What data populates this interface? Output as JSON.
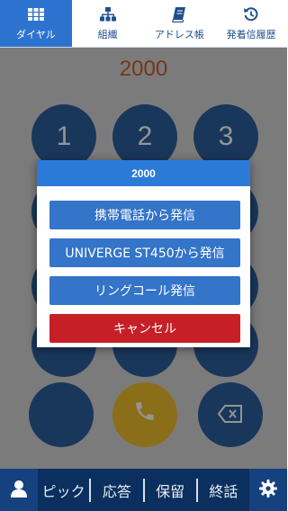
{
  "tabs": [
    {
      "label": "ダイヤル",
      "icon": "keypad-grid-icon",
      "active": true
    },
    {
      "label": "組織",
      "icon": "org-chart-icon",
      "active": false
    },
    {
      "label": "アドレス帳",
      "icon": "address-book-icon",
      "active": false
    },
    {
      "label": "発着信履歴",
      "icon": "call-history-icon",
      "active": false
    }
  ],
  "dialpad": {
    "number": "2000",
    "keys": [
      "1",
      "2",
      "3"
    ]
  },
  "dialog": {
    "title": "2000",
    "options": [
      {
        "label": "携帯電話から発信"
      },
      {
        "label": "UNIVERGE ST450から発信"
      },
      {
        "label": "リングコール発信"
      }
    ],
    "cancel_label": "キャンセル"
  },
  "bottom_bar": {
    "buttons": [
      "ピック",
      "応答",
      "保留",
      "終話"
    ],
    "left_icon": "user-icon",
    "right_icon": "gear-icon"
  },
  "colors": {
    "tab_active": "#2c73cf",
    "key": "#2c5f9e",
    "call": "#f0be2c",
    "dialog_header": "#2c7ad8",
    "cancel": "#c71f26",
    "bottom_bar": "#0b2f5e"
  }
}
